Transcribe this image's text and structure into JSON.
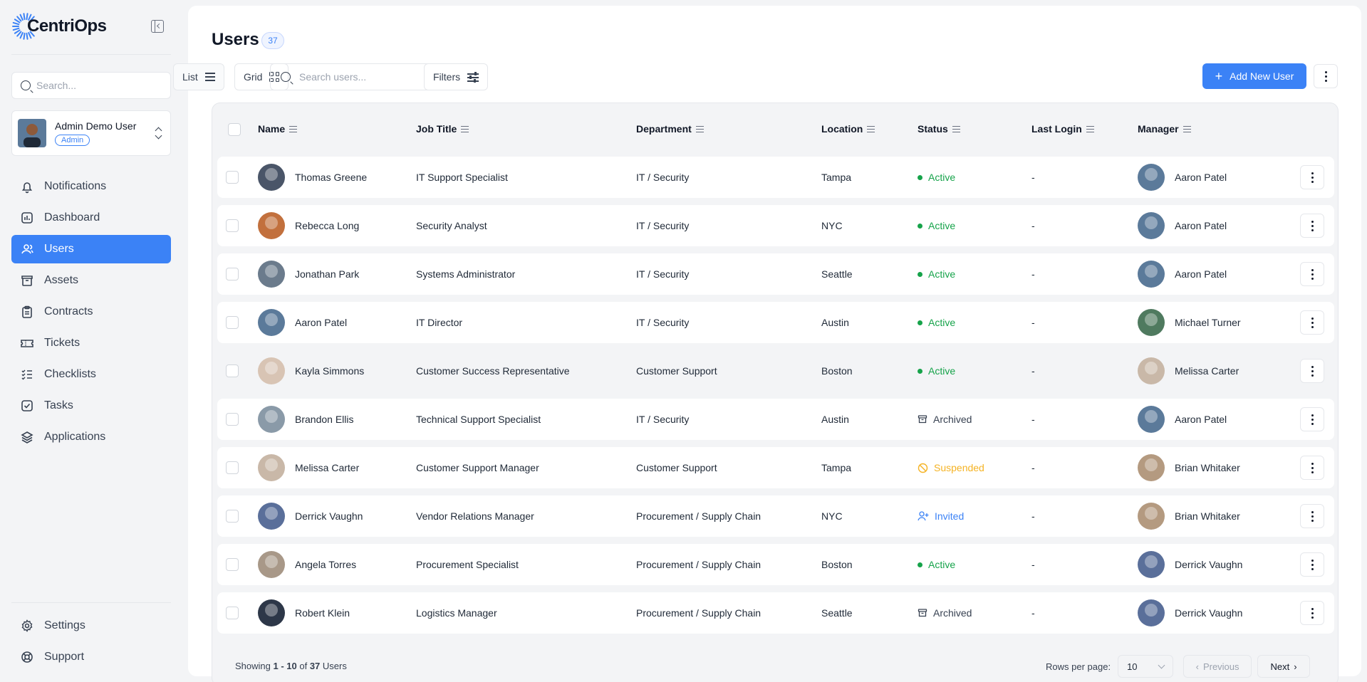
{
  "app": {
    "name": "CentriOps",
    "accent": "#3b82f6"
  },
  "sidebar": {
    "search_placeholder": "Search...",
    "user": {
      "name": "Admin Demo User",
      "role": "Admin"
    },
    "nav": [
      {
        "label": "Notifications",
        "icon": "bell-icon",
        "active": false
      },
      {
        "label": "Dashboard",
        "icon": "chart-icon",
        "active": false
      },
      {
        "label": "Users",
        "icon": "users-icon",
        "active": true
      },
      {
        "label": "Assets",
        "icon": "box-icon",
        "active": false
      },
      {
        "label": "Contracts",
        "icon": "clipboard-icon",
        "active": false
      },
      {
        "label": "Tickets",
        "icon": "ticket-icon",
        "active": false
      },
      {
        "label": "Checklists",
        "icon": "checklist-icon",
        "active": false
      },
      {
        "label": "Tasks",
        "icon": "checkbox-icon",
        "active": false
      },
      {
        "label": "Applications",
        "icon": "layers-icon",
        "active": false
      }
    ],
    "bottom_nav": [
      {
        "label": "Settings",
        "icon": "gear-icon"
      },
      {
        "label": "Support",
        "icon": "lifebuoy-icon"
      }
    ]
  },
  "header": {
    "title": "Users",
    "count": "37",
    "list_label": "List",
    "grid_label": "Grid",
    "search_placeholder": "Search users...",
    "filters_label": "Filters",
    "add_label": "Add New User"
  },
  "table": {
    "columns": [
      "Name",
      "Job Title",
      "Department",
      "Location",
      "Status",
      "Last Login",
      "Manager"
    ],
    "rows": [
      {
        "name": "Thomas Greene",
        "title": "IT Support Specialist",
        "dept": "IT / Security",
        "location": "Tampa",
        "status": "Active",
        "last_login": "-",
        "manager": "Aaron Patel"
      },
      {
        "name": "Rebecca Long",
        "title": "Security Analyst",
        "dept": "IT / Security",
        "location": "NYC",
        "status": "Active",
        "last_login": "-",
        "manager": "Aaron Patel"
      },
      {
        "name": "Jonathan Park",
        "title": "Systems Administrator",
        "dept": "IT / Security",
        "location": "Seattle",
        "status": "Active",
        "last_login": "-",
        "manager": "Aaron Patel"
      },
      {
        "name": "Aaron Patel",
        "title": "IT Director",
        "dept": "IT / Security",
        "location": "Austin",
        "status": "Active",
        "last_login": "-",
        "manager": "Michael Turner"
      },
      {
        "name": "Kayla Simmons",
        "title": "Customer Success Representative",
        "dept": "Customer Support",
        "location": "Boston",
        "status": "Active",
        "last_login": "-",
        "manager": "Melissa Carter"
      },
      {
        "name": "Brandon Ellis",
        "title": "Technical Support Specialist",
        "dept": "IT / Security",
        "location": "Austin",
        "status": "Archived",
        "last_login": "-",
        "manager": "Aaron Patel"
      },
      {
        "name": "Melissa Carter",
        "title": "Customer Support Manager",
        "dept": "Customer Support",
        "location": "Tampa",
        "status": "Suspended",
        "last_login": "-",
        "manager": "Brian Whitaker"
      },
      {
        "name": "Derrick Vaughn",
        "title": "Vendor Relations Manager",
        "dept": "Procurement / Supply Chain",
        "location": "NYC",
        "status": "Invited",
        "last_login": "-",
        "manager": "Brian Whitaker"
      },
      {
        "name": "Angela Torres",
        "title": "Procurement Specialist",
        "dept": "Procurement / Supply Chain",
        "location": "Boston",
        "status": "Active",
        "last_login": "-",
        "manager": "Derrick Vaughn"
      },
      {
        "name": "Robert Klein",
        "title": "Logistics Manager",
        "dept": "Procurement / Supply Chain",
        "location": "Seattle",
        "status": "Archived",
        "last_login": "-",
        "manager": "Derrick Vaughn"
      }
    ]
  },
  "status_colors": {
    "Active": "#16a34a",
    "Archived": "#374151",
    "Suspended": "#f5b324",
    "Invited": "#3b82f6"
  },
  "footer": {
    "showing_prefix": "Showing ",
    "showing_range": "1 - 10",
    "showing_of": " of ",
    "showing_total": "37",
    "showing_suffix": " Users",
    "rows_per_page_label": "Rows per page:",
    "rows_per_page_value": "10",
    "previous_label": "Previous",
    "next_label": "Next"
  }
}
